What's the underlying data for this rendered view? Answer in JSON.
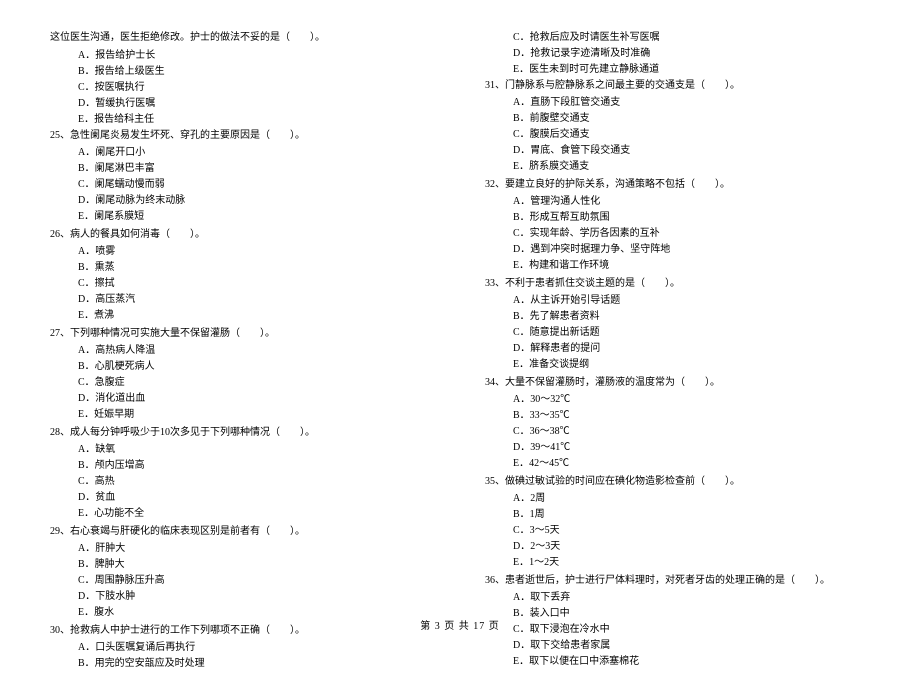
{
  "leftColumn": {
    "introLine": "这位医生沟通，医生拒绝修改。护士的做法不妥的是（　　）。",
    "introOptions": [
      "A．报告给护士长",
      "B．报告给上级医生",
      "C．按医嘱执行",
      "D．暂缓执行医嘱",
      "E．报告给科主任"
    ],
    "questions": [
      {
        "num": "25、",
        "text": "急性阑尾炎易发生坏死、穿孔的主要原因是（　　）。",
        "options": [
          "A．阑尾开口小",
          "B．阑尾淋巴丰富",
          "C．阑尾蠕动慢而弱",
          "D．阑尾动脉为终末动脉",
          "E．阑尾系膜短"
        ]
      },
      {
        "num": "26、",
        "text": "病人的餐具如何消毒（　　）。",
        "options": [
          "A．喷雾",
          "B．熏蒸",
          "C．擦拭",
          "D．高压蒸汽",
          "E．煮沸"
        ]
      },
      {
        "num": "27、",
        "text": "下列哪种情况可实施大量不保留灌肠（　　）。",
        "options": [
          "A．高热病人降温",
          "B．心肌梗死病人",
          "C．急腹症",
          "D．消化道出血",
          "E．妊娠早期"
        ]
      },
      {
        "num": "28、",
        "text": "成人每分钟呼吸少于10次多见于下列哪种情况（　　）。",
        "options": [
          "A．缺氧",
          "B．颅内压增高",
          "C．高热",
          "D．贫血",
          "E．心功能不全"
        ]
      },
      {
        "num": "29、",
        "text": "右心衰竭与肝硬化的临床表现区别是前者有（　　）。",
        "options": [
          "A．肝肿大",
          "B．脾肿大",
          "C．周围静脉压升高",
          "D．下肢水肿",
          "E．腹水"
        ]
      },
      {
        "num": "30、",
        "text": "抢救病人中护士进行的工作下列哪项不正确（　　）。",
        "options": [
          "A．口头医嘱复诵后再执行",
          "B．用完的空安瓿应及时处理"
        ]
      }
    ]
  },
  "rightColumn": {
    "topOptions": [
      "C．抢救后应及时请医生补写医嘱",
      "D．抢救记录字迹清晰及时准确",
      "E．医生未到时可先建立静脉通道"
    ],
    "questions": [
      {
        "num": "31、",
        "text": "门静脉系与腔静脉系之间最主要的交通支是（　　）。",
        "options": [
          "A．直肠下段肛管交通支",
          "B．前腹壁交通支",
          "C．腹膜后交通支",
          "D．胃底、食管下段交通支",
          "E．脐系膜交通支"
        ]
      },
      {
        "num": "32、",
        "text": "要建立良好的护际关系，沟通策略不包括（　　）。",
        "options": [
          "A．管理沟通人性化",
          "B．形成互帮互助氛围",
          "C．实现年龄、学历各因素的互补",
          "D．遇到冲突时据理力争、坚守阵地",
          "E．构建和谐工作环境"
        ]
      },
      {
        "num": "33、",
        "text": "不利于患者抓住交谈主题的是（　　）。",
        "options": [
          "A．从主诉开始引导话题",
          "B．先了解患者资料",
          "C．随意提出新话题",
          "D．解释患者的提问",
          "E．准备交谈提纲"
        ]
      },
      {
        "num": "34、",
        "text": "大量不保留灌肠时，灌肠液的温度常为（　　）。",
        "options": [
          "A．30～32℃",
          "B．33～35℃",
          "C．36～38℃",
          "D．39～41℃",
          "E．42～45℃"
        ]
      },
      {
        "num": "35、",
        "text": "做碘过敏试验的时间应在碘化物造影检查前（　　）。",
        "options": [
          "A．2周",
          "B．1周",
          "C．3～5天",
          "D．2～3天",
          "E．1～2天"
        ]
      },
      {
        "num": "36、",
        "text": "患者逝世后，护士进行尸体料理时，对死者牙齿的处理正确的是（　　）。",
        "options": [
          "A．取下丢弃",
          "B．装入口中",
          "C．取下浸泡在冷水中",
          "D．取下交给患者家属",
          "E．取下以便在口中添塞棉花"
        ]
      }
    ]
  },
  "footer": "第 3 页 共 17 页"
}
